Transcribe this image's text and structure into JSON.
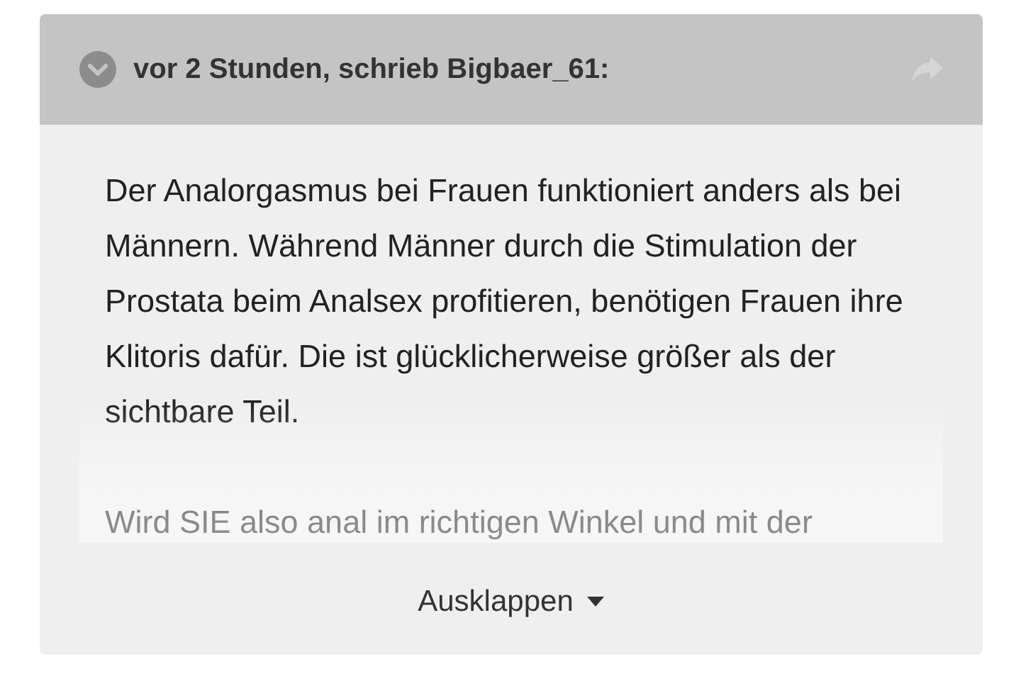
{
  "quote": {
    "header": "vor 2 Stunden, schrieb Bigbaer_61:",
    "paragraphs": [
      "Der Analorgasmus bei Frauen funktioniert anders als bei Männern. Während Männer durch die Stimulation der Prostata beim Analsex profitieren, benötigen Frauen ihre Klitoris dafür. Die ist glücklicherweise größer als der sichtbare Teil.",
      "Wird SIE also anal im richtigen Winkel und mit der"
    ],
    "expanded": false,
    "expand_label": "Ausklappen"
  }
}
